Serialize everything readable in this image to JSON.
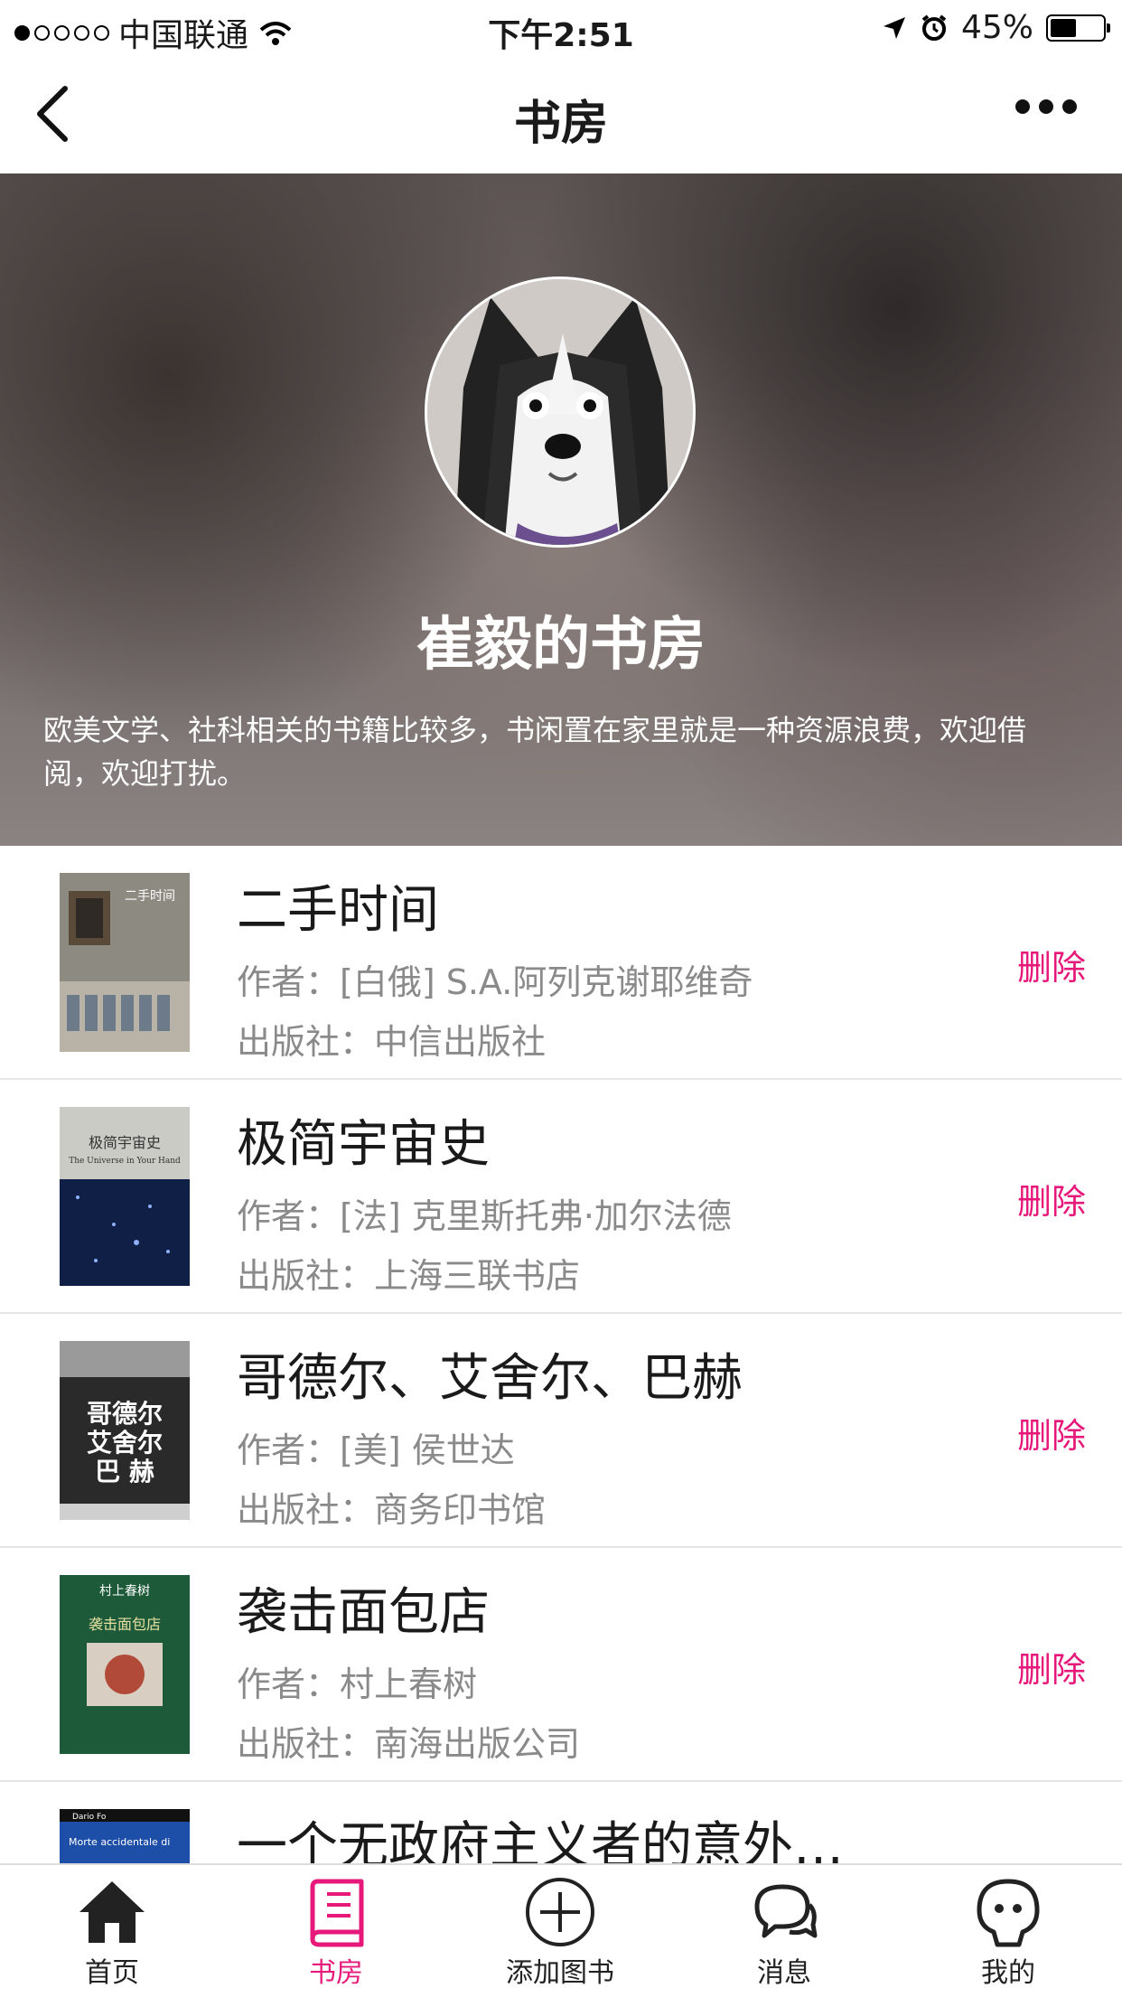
{
  "status_bar": {
    "carrier": "中国联通",
    "time": "下午2:51",
    "battery": "45%"
  },
  "nav": {
    "title": "书房"
  },
  "profile": {
    "name": "崔毅的书房",
    "description": "欧美文学、社科相关的书籍比较多，书闲置在家里就是一种资源浪费，欢迎借阅，欢迎打扰。"
  },
  "books": [
    {
      "title": "二手时间",
      "author": "作者：[白俄] S.A.阿列克谢耶维奇",
      "publisher": "出版社：中信出版社",
      "action": "删除",
      "cover_text": "二手时间"
    },
    {
      "title": "极简宇宙史",
      "author": "作者：[法] 克里斯托弗·加尔法德",
      "publisher": "出版社：上海三联书店",
      "action": "删除",
      "cover_text": "极简宇宙史",
      "cover_subtext": "The Universe in Your Hand"
    },
    {
      "title": "哥德尔、艾舍尔、巴赫",
      "author": "作者：[美] 侯世达",
      "publisher": "出版社：商务印书馆",
      "action": "删除",
      "cover_text": "哥德尔 艾舍尔 巴赫"
    },
    {
      "title": "袭击面包店",
      "author": "作者：村上春树",
      "publisher": "出版社：南海出版公司",
      "action": "删除",
      "cover_text": "村上春树",
      "cover_subtext": "袭击面包店"
    },
    {
      "title": "一个无政府主义者的意外…",
      "cover_text": "Morte accidentale di",
      "cover_subtext": "Dario Fo"
    }
  ],
  "tabs": [
    {
      "label": "首页",
      "icon": "home-icon"
    },
    {
      "label": "书房",
      "icon": "book-icon"
    },
    {
      "label": "添加图书",
      "icon": "add-circle-icon"
    },
    {
      "label": "消息",
      "icon": "chat-icon"
    },
    {
      "label": "我的",
      "icon": "profile-icon"
    }
  ],
  "colors": {
    "accent": "#e6197a",
    "text": "#1a1a1a",
    "secondary": "#8a8a8a"
  }
}
